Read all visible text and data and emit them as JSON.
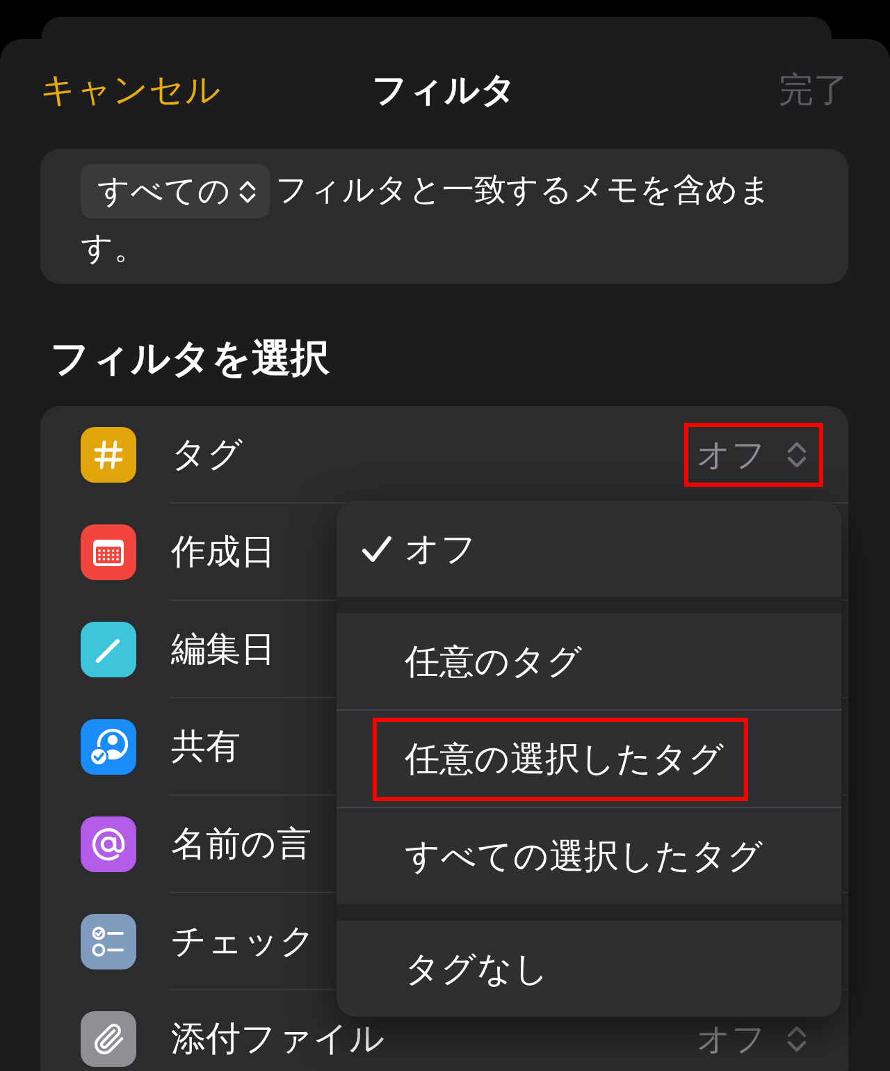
{
  "header": {
    "cancel": "キャンセル",
    "title": "フィルタ",
    "done": {
      "label": "完了",
      "disabled": true
    }
  },
  "description": {
    "match_button": "すべての",
    "text": "フィルタと一致するメモを含めます。"
  },
  "section_title": "フィルタを選択",
  "filters": [
    {
      "kind": "tag",
      "label": "タグ",
      "value": {
        "text": "オフ",
        "highlighted": true
      }
    },
    {
      "kind": "created",
      "label": "作成日"
    },
    {
      "kind": "edited",
      "label": "編集日"
    },
    {
      "kind": "shared",
      "label": "共有"
    },
    {
      "kind": "mentions",
      "label": "名前の言"
    },
    {
      "kind": "checklist",
      "label": "チェック"
    },
    {
      "kind": "attachments",
      "label": "添付ファイル",
      "value": {
        "text": "オフ",
        "highlighted": false
      }
    }
  ],
  "menu": {
    "groups": [
      {
        "options": [
          {
            "label": "オフ",
            "selected": true,
            "highlighted": false
          }
        ]
      },
      {
        "options": [
          {
            "label": "任意のタグ",
            "selected": false,
            "highlighted": false
          },
          {
            "label": "任意の選択したタグ",
            "selected": false,
            "highlighted": true
          },
          {
            "label": "すべての選択したタグ",
            "selected": false,
            "highlighted": false
          }
        ]
      },
      {
        "options": [
          {
            "label": "タグなし",
            "selected": false,
            "highlighted": false
          }
        ]
      }
    ]
  }
}
